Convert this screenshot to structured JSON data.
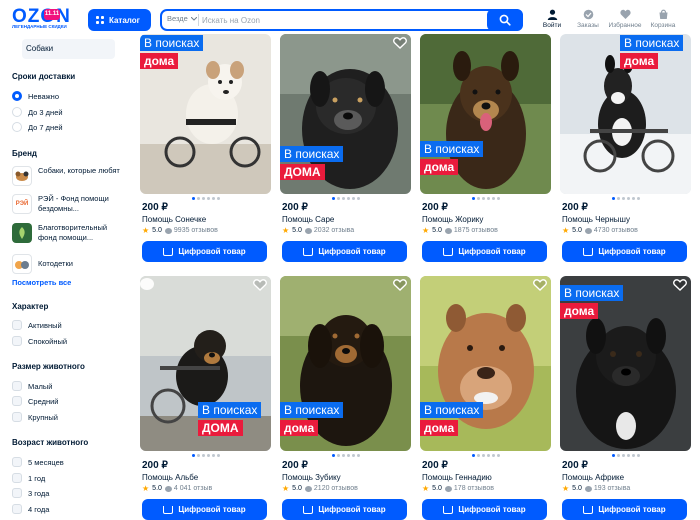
{
  "header": {
    "logo_text": "OZON",
    "logo_badge": "11.11",
    "logo_subtitle": "ЛЕГЕНДАРНЫЕ СКИДКИ",
    "catalog_label": "Каталог",
    "search_scope": "Везде",
    "search_placeholder": "Искать на Ozon",
    "nav": [
      {
        "label": "Войти",
        "icon": "user-icon"
      },
      {
        "label": "Заказы",
        "icon": "box-icon"
      },
      {
        "label": "Избранное",
        "icon": "heart-icon"
      },
      {
        "label": "Корзина",
        "icon": "cart-icon"
      }
    ],
    "accent": "#005bff"
  },
  "sidebar": {
    "category_value": "Собаки",
    "delivery": {
      "title": "Сроки доставки",
      "options": [
        "Неважно",
        "До 3 дней",
        "До 7 дней"
      ],
      "selected": "Неважно"
    },
    "brand": {
      "title": "Бренд",
      "items": [
        {
          "label": "Собаки, которые любят",
          "logo": "dog-logo"
        },
        {
          "label": "РЭЙ - Фонд помощи бездомны...",
          "logo": "rei-logo",
          "logo_text": "РЭЙ"
        },
        {
          "label": "Благотворительный фонд помощи...",
          "logo": "charity-logo"
        },
        {
          "label": "Котодетки",
          "logo": "kotodetki-logo"
        }
      ],
      "see_all": "Посмотреть все"
    },
    "character": {
      "title": "Характер",
      "options": [
        "Активный",
        "Спокойный"
      ]
    },
    "size": {
      "title": "Размер животного",
      "options": [
        "Малый",
        "Средний",
        "Крупный"
      ]
    },
    "age": {
      "title": "Возраст животного",
      "options": [
        "5 месяцев",
        "1 год",
        "3 года",
        "4 года"
      ]
    }
  },
  "products": [
    {
      "price": "200 ₽",
      "name": "Помощь Сонечке",
      "rating": "5.0",
      "reviews": "9935 отзывов",
      "button": "Цифровой товар",
      "banner_line1": "В поисках",
      "banner_line2": "дома"
    },
    {
      "price": "200 ₽",
      "name": "Помощь Саре",
      "rating": "5.0",
      "reviews": "2032 отзыва",
      "button": "Цифровой товар",
      "banner_line1": "В поисках",
      "banner_line2": "ДОМА"
    },
    {
      "price": "200 ₽",
      "name": "Помощь Жорику",
      "rating": "5.0",
      "reviews": "1875 отзывов",
      "button": "Цифровой товар",
      "banner_line1": "В поисках",
      "banner_line2": "дома"
    },
    {
      "price": "200 ₽",
      "name": "Помощь Чернышу",
      "rating": "5.0",
      "reviews": "4730 отзывов",
      "button": "Цифровой товар",
      "banner_line1": "В поисках",
      "banner_line2": "дома"
    },
    {
      "price": "200 ₽",
      "name": "Помощь Альбе",
      "rating": "5.0",
      "reviews": "4 041 отзыв",
      "button": "Цифровой товар",
      "banner_line1": "В поисках",
      "banner_line2": "ДОМА"
    },
    {
      "price": "200 ₽",
      "name": "Помощь Зубику",
      "rating": "5.0",
      "reviews": "2120 отзывов",
      "button": "Цифровой товар",
      "banner_line1": "В поисках",
      "banner_line2": "дома"
    },
    {
      "price": "200 ₽",
      "name": "Помощь Геннадию",
      "rating": "5.0",
      "reviews": "178 отзывов",
      "button": "Цифровой товар",
      "banner_line1": "В поисках",
      "banner_line2": "дома"
    },
    {
      "price": "200 ₽",
      "name": "Помощь Африке",
      "rating": "5.0",
      "reviews": "193 отзыва",
      "button": "Цифровой товар",
      "banner_line1": "В поисках",
      "banner_line2": "дома"
    }
  ]
}
